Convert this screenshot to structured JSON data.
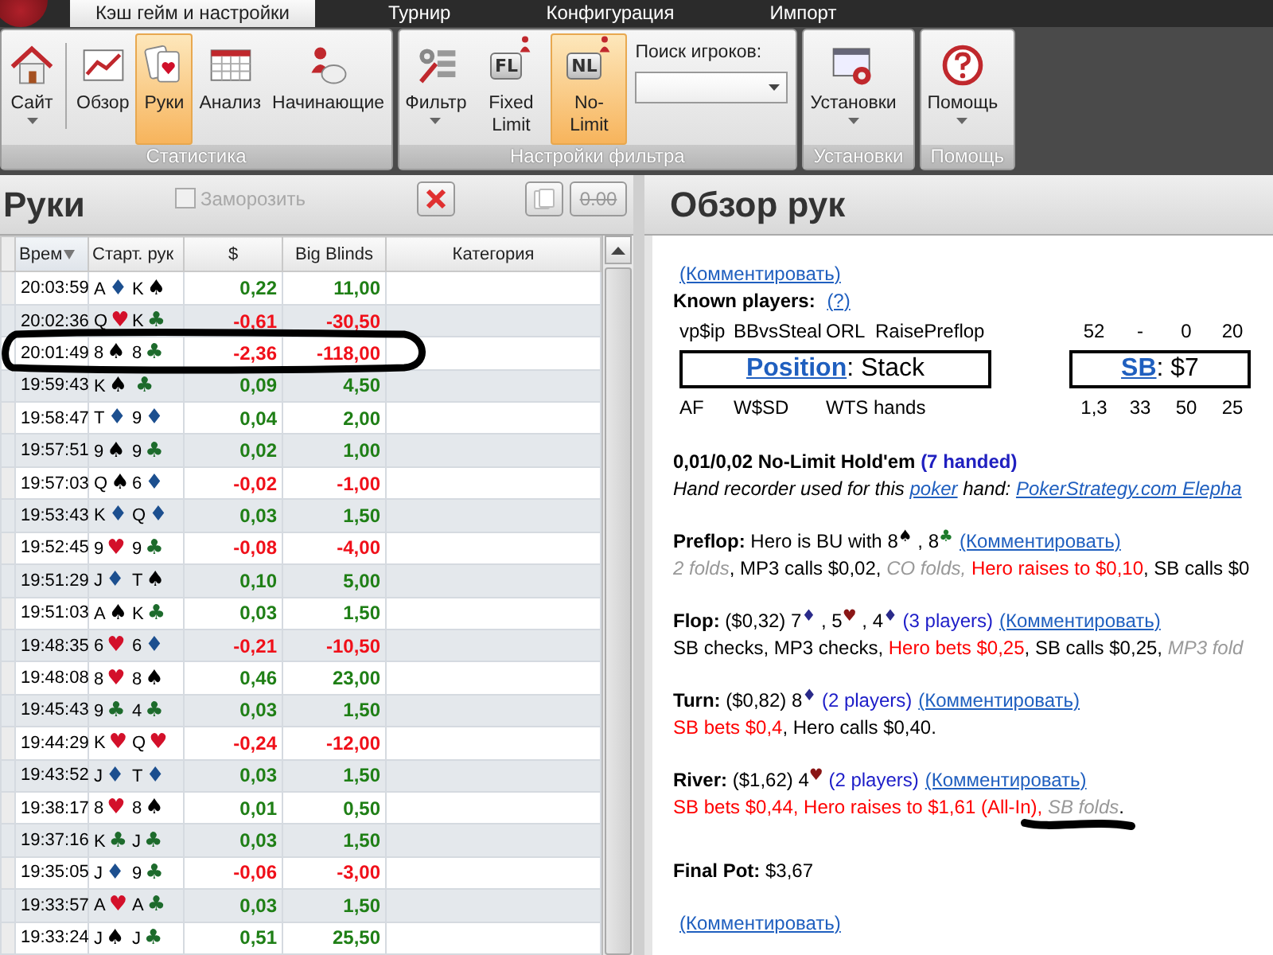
{
  "app": {
    "tabs": [
      {
        "label": "Кэш гейм и настройки",
        "selected": true
      },
      {
        "label": "Турнир",
        "selected": false
      },
      {
        "label": "Конфигурация",
        "selected": false
      },
      {
        "label": "Импорт",
        "selected": false
      }
    ]
  },
  "ribbon": {
    "groups": [
      {
        "label": "Статистика",
        "items": [
          {
            "kind": "button",
            "label": "Сайт",
            "dropdown": true,
            "selected": false
          },
          {
            "kind": "separator"
          },
          {
            "kind": "button",
            "label": "Обзор",
            "dropdown": false,
            "selected": false
          },
          {
            "kind": "button",
            "label": "Руки",
            "dropdown": false,
            "selected": true
          },
          {
            "kind": "button",
            "label": "Анализ",
            "dropdown": false,
            "selected": false
          },
          {
            "kind": "button",
            "label": "Начинающие",
            "dropdown": false,
            "selected": false
          }
        ]
      },
      {
        "label": "Настройки фильтра",
        "items": [
          {
            "kind": "button",
            "label": "Фильтр",
            "dropdown": true,
            "selected": false
          },
          {
            "kind": "button",
            "label": "Fixed Limit",
            "badge": "FL",
            "dropdown": false,
            "selected": false
          },
          {
            "kind": "button",
            "label": "No-Limit",
            "badge": "NL",
            "dropdown": false,
            "selected": true
          },
          {
            "kind": "search",
            "label": "Поиск игроков:"
          }
        ]
      },
      {
        "label": "Установки",
        "items": [
          {
            "kind": "button",
            "label": "Установки",
            "dropdown": true,
            "selected": false
          }
        ]
      },
      {
        "label": "Помощь",
        "items": [
          {
            "kind": "button",
            "label": "Помощь",
            "dropdown": true,
            "selected": false
          }
        ]
      }
    ]
  },
  "hands": {
    "title": "Руки",
    "freeze": {
      "label": "Заморозить",
      "checked": false,
      "disabled": true
    },
    "amount_button": {
      "label": "0.00",
      "disabled": true
    },
    "columns": [
      {
        "label": "Врем",
        "sorted": true
      },
      {
        "label": "Старт. рук",
        "sorted": false
      },
      {
        "label": "$",
        "sorted": false
      },
      {
        "label": "Big Blinds",
        "sorted": false
      },
      {
        "label": "Категория",
        "sorted": false
      }
    ],
    "rows": [
      {
        "time": "20:03:59",
        "cards": [
          {
            "rank": "A",
            "suit": "♦",
            "color": "#1c4f8f"
          },
          {
            "rank": "K",
            "suit": "♠",
            "color": "#000000"
          }
        ],
        "amount": "0,22",
        "bb": "11,00",
        "color": "#1f7f16",
        "selected": false
      },
      {
        "time": "20:02:36",
        "cards": [
          {
            "rank": "Q",
            "suit": "♥",
            "color": "#d3102a"
          },
          {
            "rank": "K",
            "suit": "♣",
            "color": "#1d6b2c"
          }
        ],
        "amount": "-0,61",
        "bb": "-30,50",
        "color": "#f0101a",
        "selected": false
      },
      {
        "time": "20:01:49",
        "cards": [
          {
            "rank": "8",
            "suit": "♠",
            "color": "#000000"
          },
          {
            "rank": "8",
            "suit": "♣",
            "color": "#1d6b2c"
          }
        ],
        "amount": "-2,36",
        "bb": "-118,00",
        "color": "#f0101a",
        "selected": true
      },
      {
        "time": "19:59:43",
        "cards": [
          {
            "rank": "K",
            "suit": "♠",
            "color": "#000000"
          },
          {
            "suit": "♣",
            "color": "#1d6b2c"
          }
        ],
        "amount": "0,09",
        "bb": "4,50",
        "color": "#1f7f16",
        "selected": false
      },
      {
        "time": "19:58:47",
        "cards": [
          {
            "rank": "T",
            "suit": "♦",
            "color": "#1c4f8f"
          },
          {
            "rank": "9",
            "suit": "♦",
            "color": "#1c4f8f"
          }
        ],
        "amount": "0,04",
        "bb": "2,00",
        "color": "#1f7f16",
        "selected": false
      },
      {
        "time": "19:57:51",
        "cards": [
          {
            "rank": "9",
            "suit": "♠",
            "color": "#000000"
          },
          {
            "rank": "9",
            "suit": "♣",
            "color": "#1d6b2c"
          }
        ],
        "amount": "0,02",
        "bb": "1,00",
        "color": "#1f7f16",
        "selected": false
      },
      {
        "time": "19:57:03",
        "cards": [
          {
            "rank": "Q",
            "suit": "♠",
            "color": "#000000"
          },
          {
            "rank": "6",
            "suit": "♦",
            "color": "#1c4f8f"
          }
        ],
        "amount": "-0,02",
        "bb": "-1,00",
        "color": "#f0101a",
        "selected": false
      },
      {
        "time": "19:53:43",
        "cards": [
          {
            "rank": "K",
            "suit": "♦",
            "color": "#1c4f8f"
          },
          {
            "rank": "Q",
            "suit": "♦",
            "color": "#1c4f8f"
          }
        ],
        "amount": "0,03",
        "bb": "1,50",
        "color": "#1f7f16",
        "selected": false
      },
      {
        "time": "19:52:45",
        "cards": [
          {
            "rank": "9",
            "suit": "♥",
            "color": "#d3102a"
          },
          {
            "rank": "9",
            "suit": "♣",
            "color": "#1d6b2c"
          }
        ],
        "amount": "-0,08",
        "bb": "-4,00",
        "color": "#f0101a",
        "selected": false
      },
      {
        "time": "19:51:29",
        "cards": [
          {
            "rank": "J",
            "suit": "♦",
            "color": "#1c4f8f"
          },
          {
            "rank": "T",
            "suit": "♠",
            "color": "#000000"
          }
        ],
        "amount": "0,10",
        "bb": "5,00",
        "color": "#1f7f16",
        "selected": false
      },
      {
        "time": "19:51:03",
        "cards": [
          {
            "rank": "A",
            "suit": "♠",
            "color": "#000000"
          },
          {
            "rank": "K",
            "suit": "♣",
            "color": "#1d6b2c"
          }
        ],
        "amount": "0,03",
        "bb": "1,50",
        "color": "#1f7f16",
        "selected": false
      },
      {
        "time": "19:48:35",
        "cards": [
          {
            "rank": "6",
            "suit": "♥",
            "color": "#d3102a"
          },
          {
            "rank": "6",
            "suit": "♦",
            "color": "#1c4f8f"
          }
        ],
        "amount": "-0,21",
        "bb": "-10,50",
        "color": "#f0101a",
        "selected": false
      },
      {
        "time": "19:48:08",
        "cards": [
          {
            "rank": "8",
            "suit": "♥",
            "color": "#d3102a"
          },
          {
            "rank": "8",
            "suit": "♠",
            "color": "#000000"
          }
        ],
        "amount": "0,46",
        "bb": "23,00",
        "color": "#1f7f16",
        "selected": false
      },
      {
        "time": "19:45:43",
        "cards": [
          {
            "rank": "9",
            "suit": "♣",
            "color": "#1d6b2c"
          },
          {
            "rank": "4",
            "suit": "♣",
            "color": "#1d6b2c"
          }
        ],
        "amount": "0,03",
        "bb": "1,50",
        "color": "#1f7f16",
        "selected": false
      },
      {
        "time": "19:44:29",
        "cards": [
          {
            "rank": "K",
            "suit": "♥",
            "color": "#d3102a"
          },
          {
            "rank": "Q",
            "suit": "♥",
            "color": "#d3102a"
          }
        ],
        "amount": "-0,24",
        "bb": "-12,00",
        "color": "#f0101a",
        "selected": false
      },
      {
        "time": "19:43:52",
        "cards": [
          {
            "rank": "J",
            "suit": "♦",
            "color": "#1c4f8f"
          },
          {
            "rank": "T",
            "suit": "♦",
            "color": "#1c4f8f"
          }
        ],
        "amount": "0,03",
        "bb": "1,50",
        "color": "#1f7f16",
        "selected": false
      },
      {
        "time": "19:38:17",
        "cards": [
          {
            "rank": "8",
            "suit": "♥",
            "color": "#d3102a"
          },
          {
            "rank": "8",
            "suit": "♠",
            "color": "#000000"
          }
        ],
        "amount": "0,01",
        "bb": "0,50",
        "color": "#1f7f16",
        "selected": false
      },
      {
        "time": "19:37:16",
        "cards": [
          {
            "rank": "K",
            "suit": "♣",
            "color": "#1d6b2c"
          },
          {
            "rank": "J",
            "suit": "♣",
            "color": "#1d6b2c"
          }
        ],
        "amount": "0,03",
        "bb": "1,50",
        "color": "#1f7f16",
        "selected": false
      },
      {
        "time": "19:35:05",
        "cards": [
          {
            "rank": "J",
            "suit": "♦",
            "color": "#1c4f8f"
          },
          {
            "rank": "9",
            "suit": "♣",
            "color": "#1d6b2c"
          }
        ],
        "amount": "-0,06",
        "bb": "-3,00",
        "color": "#f0101a",
        "selected": false
      },
      {
        "time": "19:33:57",
        "cards": [
          {
            "rank": "A",
            "suit": "♥",
            "color": "#d3102a"
          },
          {
            "rank": "A",
            "suit": "♣",
            "color": "#1d6b2c"
          }
        ],
        "amount": "0,03",
        "bb": "1,50",
        "color": "#1f7f16",
        "selected": false
      },
      {
        "time": "19:33:24",
        "cards": [
          {
            "rank": "J",
            "suit": "♠",
            "color": "#000000"
          },
          {
            "rank": "J",
            "suit": "♣",
            "color": "#1d6b2c"
          }
        ],
        "amount": "0,51",
        "bb": "25,50",
        "color": "#1f7f16",
        "selected": false
      }
    ]
  },
  "overview": {
    "title": "Обзор рук",
    "sections": [
      [
        {
          "kind": "text",
          "segments": [
            {
              "kind": "link",
              "text": "(Комментировать)"
            }
          ]
        },
        {
          "kind": "text",
          "segments": [
            {
              "kind": "bold",
              "text": "Known players: "
            },
            {
              "kind": "link",
              "text": "(?)"
            }
          ]
        },
        {
          "kind": "stats",
          "labels": [
            "vp$ip",
            "BBvsSteal",
            "ORL",
            "RaisePreflop"
          ],
          "values": [
            "52",
            "-",
            "0",
            "20"
          ]
        },
        {
          "kind": "boxes",
          "boxes": [
            {
              "link": "Position",
              "text": ": Stack"
            },
            {
              "link": "SB",
              "text": ": $7"
            }
          ]
        },
        {
          "kind": "stats",
          "labels": [
            "AF",
            "W$SD",
            "WTS hands"
          ],
          "values": [
            "1,3",
            "33",
            "50",
            "25"
          ]
        }
      ],
      [
        {
          "kind": "text",
          "segments": [
            {
              "kind": "bold",
              "text": "0,01/0,02 No-Limit Hold'em "
            },
            {
              "kind": "bold-blue",
              "text": "(7 handed)"
            }
          ]
        },
        {
          "kind": "text",
          "segments": [
            {
              "kind": "italic",
              "text": "Hand recorder used for this "
            },
            {
              "kind": "italic-link",
              "text": "poker"
            },
            {
              "kind": "italic",
              "text": " hand: "
            },
            {
              "kind": "italic-link",
              "text": "PokerStrategy.com Elepha"
            }
          ]
        }
      ],
      [
        {
          "kind": "text",
          "segments": [
            {
              "kind": "bold",
              "text": "Preflop: "
            },
            {
              "kind": "plain",
              "text": "Hero is BU with 8"
            },
            {
              "kind": "suit",
              "text": "♠",
              "color": "#000000"
            },
            {
              "kind": "plain",
              "text": " , 8"
            },
            {
              "kind": "suit",
              "text": "♣",
              "color": "#1d7b2c"
            },
            {
              "kind": "link",
              "text": "(Комментировать)"
            }
          ]
        },
        {
          "kind": "text",
          "segments": [
            {
              "kind": "muted",
              "text": "2 folds"
            },
            {
              "kind": "plain",
              "text": ", MP3 calls $0,02, "
            },
            {
              "kind": "muted",
              "text": "CO folds, "
            },
            {
              "kind": "red",
              "text": "Hero raises to $0,10"
            },
            {
              "kind": "plain",
              "text": ", SB calls $0"
            }
          ]
        }
      ],
      [
        {
          "kind": "text",
          "segments": [
            {
              "kind": "bold",
              "text": "Flop: "
            },
            {
              "kind": "plain",
              "text": "($0,32) 7"
            },
            {
              "kind": "suit",
              "text": "♦",
              "color": "#2a2a8a"
            },
            {
              "kind": "plain",
              "text": " , 5"
            },
            {
              "kind": "suit",
              "text": "♥",
              "color": "#8a1616"
            },
            {
              "kind": "plain",
              "text": " , 4"
            },
            {
              "kind": "suit",
              "text": "♦",
              "color": "#2a2a8a"
            },
            {
              "kind": "blue",
              "text": " (3 players)"
            },
            {
              "kind": "link",
              "text": "(Комментировать)"
            }
          ]
        },
        {
          "kind": "text",
          "segments": [
            {
              "kind": "plain",
              "text": "SB checks, MP3 checks, "
            },
            {
              "kind": "red",
              "text": "Hero bets $0,25"
            },
            {
              "kind": "plain",
              "text": ", SB calls $0,25, "
            },
            {
              "kind": "muted",
              "text": "MP3 fold"
            }
          ]
        }
      ],
      [
        {
          "kind": "text",
          "segments": [
            {
              "kind": "bold",
              "text": "Turn: "
            },
            {
              "kind": "plain",
              "text": "($0,82) 8"
            },
            {
              "kind": "suit",
              "text": "♦",
              "color": "#2a2a8a"
            },
            {
              "kind": "blue",
              "text": " (2 players)"
            },
            {
              "kind": "link",
              "text": "(Комментировать)"
            }
          ]
        },
        {
          "kind": "text",
          "segments": [
            {
              "kind": "red",
              "text": "SB bets $0,4"
            },
            {
              "kind": "plain",
              "text": ", Hero calls $0,40."
            }
          ]
        }
      ],
      [
        {
          "kind": "text",
          "segments": [
            {
              "kind": "bold",
              "text": "River: "
            },
            {
              "kind": "plain",
              "text": "($1,62) 4"
            },
            {
              "kind": "suit",
              "text": "♥",
              "color": "#8a1616"
            },
            {
              "kind": "blue",
              "text": " (2 players)"
            },
            {
              "kind": "link",
              "text": "(Комментировать)"
            }
          ]
        },
        {
          "kind": "text",
          "segments": [
            {
              "kind": "red",
              "text": "SB bets $0,44, Hero raises to $1,61 (All-In), "
            },
            {
              "kind": "muted",
              "text": "SB folds",
              "underlined": true
            },
            {
              "kind": "plain",
              "text": "."
            }
          ]
        }
      ],
      [
        {
          "kind": "text",
          "segments": [
            {
              "kind": "bold",
              "text": "Final Pot: "
            },
            {
              "kind": "plain",
              "text": "$3,67"
            }
          ]
        }
      ],
      [
        {
          "kind": "text",
          "segments": [
            {
              "kind": "link",
              "text": "(Комментировать)"
            }
          ]
        }
      ]
    ]
  }
}
